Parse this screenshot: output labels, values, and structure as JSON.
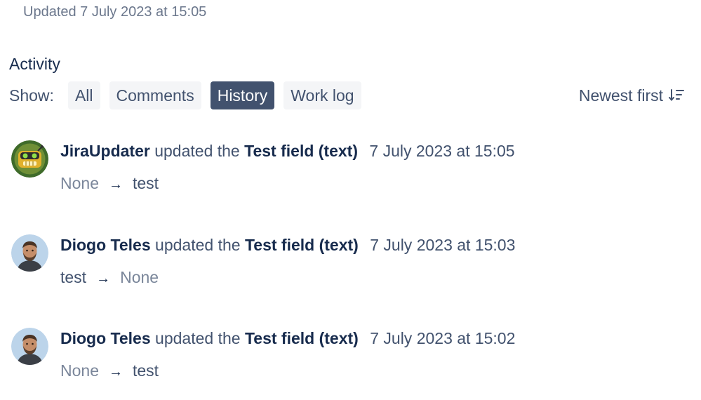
{
  "header": {
    "updated_text": "Updated 7 July 2023 at 15:05"
  },
  "activity": {
    "title": "Activity",
    "show_label": "Show:",
    "tabs": [
      {
        "label": "All",
        "selected": false
      },
      {
        "label": "Comments",
        "selected": false
      },
      {
        "label": "History",
        "selected": true
      },
      {
        "label": "Work log",
        "selected": false
      }
    ],
    "sort_label": "Newest first",
    "sort_icon": "sort-descending-icon"
  },
  "entries": [
    {
      "author": "JiraUpdater",
      "avatar": "robot-avatar",
      "verb": "updated the",
      "field": "Test field (text)",
      "time": "7 July 2023 at 15:05",
      "from": "None",
      "arrow": "→",
      "to": "test"
    },
    {
      "author": "Diogo Teles",
      "avatar": "person-avatar",
      "verb": "updated the",
      "field": "Test field (text)",
      "time": "7 July 2023 at 15:03",
      "from": "test",
      "arrow": "→",
      "to": "None"
    },
    {
      "author": "Diogo Teles",
      "avatar": "person-avatar",
      "verb": "updated the",
      "field": "Test field (text)",
      "time": "7 July 2023 at 15:02",
      "from": "None",
      "arrow": "→",
      "to": "test"
    }
  ],
  "colors": {
    "text": "#172b4d",
    "subtle_text": "#42526e",
    "muted_text": "#7a869a",
    "tab_bg": "#f4f5f7",
    "tab_selected_bg": "#42526e"
  }
}
